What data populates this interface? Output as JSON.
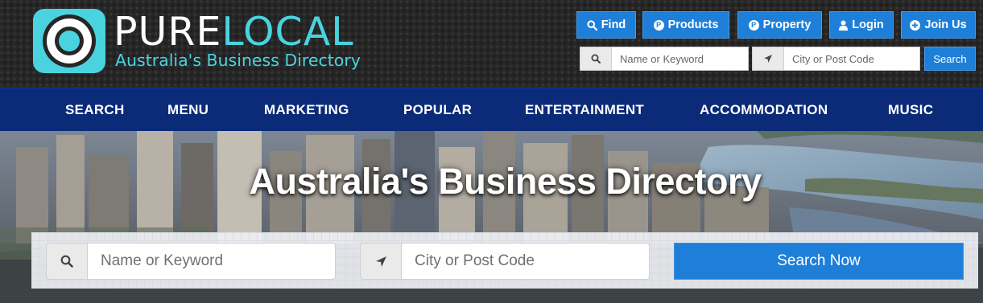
{
  "header": {
    "logo": {
      "word_part1": "PURE",
      "word_part2": "LOCAL",
      "tagline": "Australia's Business Directory"
    },
    "top_buttons": [
      {
        "label": "Find",
        "icon": "search-icon"
      },
      {
        "label": "Products",
        "icon": "p-circle-icon",
        "icon_glyph": "P"
      },
      {
        "label": "Property",
        "icon": "p-circle-icon",
        "icon_glyph": "P"
      },
      {
        "label": "Login",
        "icon": "user-icon"
      },
      {
        "label": "Join Us",
        "icon": "plus-circle-icon"
      }
    ],
    "mini_search": {
      "keyword_placeholder": "Name or Keyword",
      "location_placeholder": "City or Post Code",
      "button_label": "Search"
    }
  },
  "nav": {
    "items": [
      "SEARCH",
      "MENU",
      "MARKETING",
      "POPULAR",
      "ENTERTAINMENT",
      "ACCOMMODATION",
      "MUSIC"
    ]
  },
  "hero": {
    "title": "Australia's Business Directory",
    "search": {
      "keyword_placeholder": "Name or Keyword",
      "location_placeholder": "City or Post Code",
      "button_label": "Search Now"
    }
  },
  "colors": {
    "accent_blue": "#1e7fd9",
    "nav_navy": "#0b2a78",
    "logo_cyan": "#4ad3df"
  }
}
